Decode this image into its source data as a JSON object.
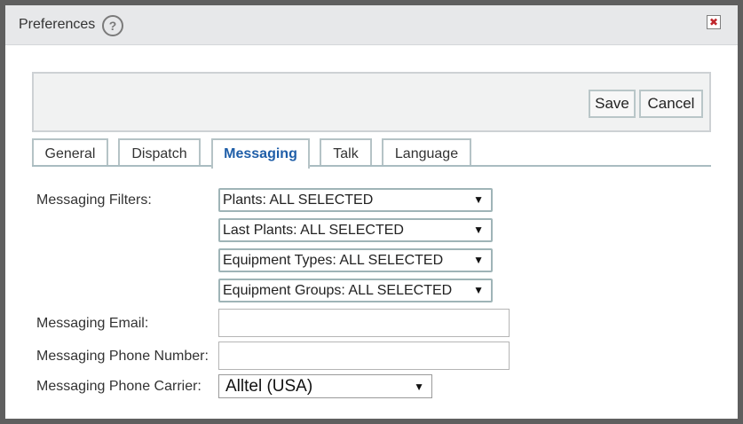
{
  "dialog": {
    "title": "Preferences",
    "help_icon": "?",
    "close_icon": "✖"
  },
  "toolbar": {
    "save_label": "Save",
    "cancel_label": "Cancel"
  },
  "tabs": [
    {
      "label": "General"
    },
    {
      "label": "Dispatch"
    },
    {
      "label": "Messaging",
      "active": true
    },
    {
      "label": "Talk"
    },
    {
      "label": "Language"
    }
  ],
  "messaging": {
    "filters_label": "Messaging Filters:",
    "filters": [
      {
        "value": "Plants: ALL SELECTED"
      },
      {
        "value": "Last Plants: ALL SELECTED"
      },
      {
        "value": "Equipment Types: ALL SELECTED"
      },
      {
        "value": "Equipment Groups: ALL SELECTED"
      }
    ],
    "email_label": "Messaging Email:",
    "email_value": "",
    "phone_label": "Messaging Phone Number:",
    "phone_value": "",
    "carrier_label": "Messaging Phone Carrier:",
    "carrier_value": "Alltel (USA)"
  },
  "icons": {
    "dropdown_arrow": "▼"
  },
  "colors": {
    "active_tab": "#1f5ea8",
    "close_icon": "#c0282d",
    "titlebar_bg": "#e7e8ea"
  }
}
